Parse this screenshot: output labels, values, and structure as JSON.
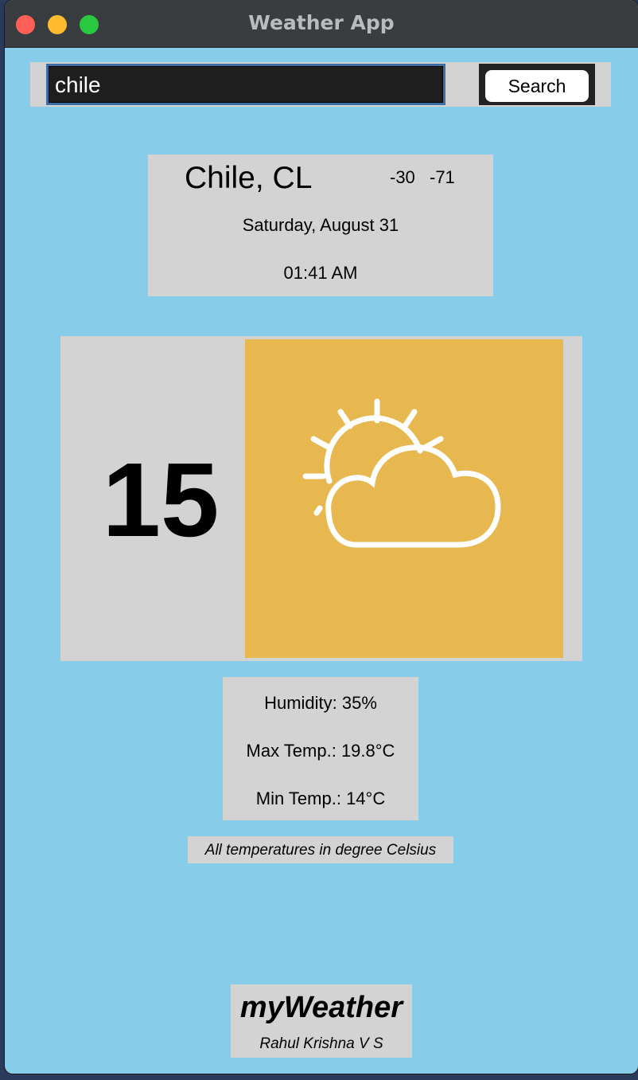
{
  "window": {
    "title": "Weather App"
  },
  "search": {
    "value": "chile",
    "button_label": "Search"
  },
  "location": {
    "city": "Chile, CL",
    "lat": "-30",
    "lon": "-71",
    "date": "Saturday, August 31",
    "time": "01:41 AM"
  },
  "current": {
    "temperature": "15",
    "icon": "partly-cloudy-icon",
    "icon_bg_color": "#e8b850"
  },
  "stats": {
    "humidity": "Humidity: 35%",
    "max_temp": "Max Temp.: 19.8°C",
    "min_temp": "Min Temp.: 14°C"
  },
  "note": "All temperatures in degree Celsius",
  "brand": {
    "name": "myWeather",
    "author": "Rahul Krishna V S"
  },
  "colors": {
    "background": "#87cdea",
    "panel": "#d3d3d3"
  }
}
